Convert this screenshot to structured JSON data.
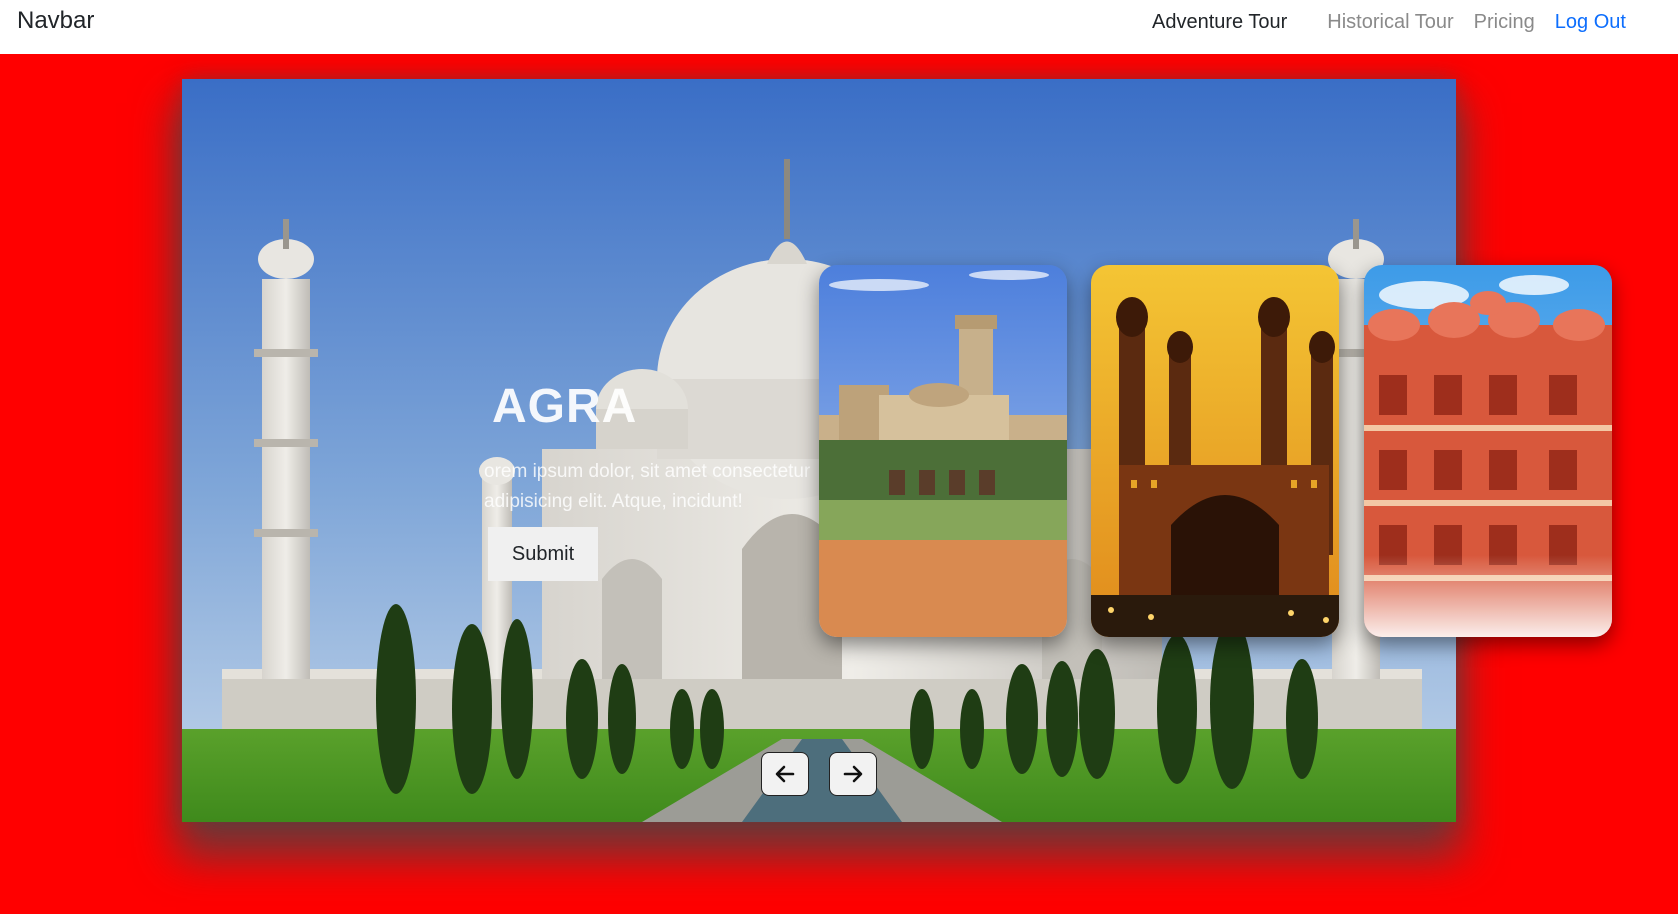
{
  "navbar": {
    "brand": "Navbar",
    "links": [
      {
        "label": "Adventure Tour"
      },
      {
        "label": "Historical Tour"
      },
      {
        "label": "Pricing"
      },
      {
        "label": "Log Out"
      }
    ]
  },
  "hero": {
    "background_color": "#ff0000",
    "slide": {
      "title": "AGRA",
      "text": "orem ipsum dolor, sit amet consectetur adipisicing elit. Atque, incidunt!",
      "button_label": "Submit"
    },
    "cards": [
      {
        "name": "palace-card"
      },
      {
        "name": "charminar-card"
      },
      {
        "name": "hawa-mahal-card"
      }
    ],
    "arrows": {
      "prev_icon": "arrow-left-icon",
      "next_icon": "arrow-right-icon"
    }
  }
}
